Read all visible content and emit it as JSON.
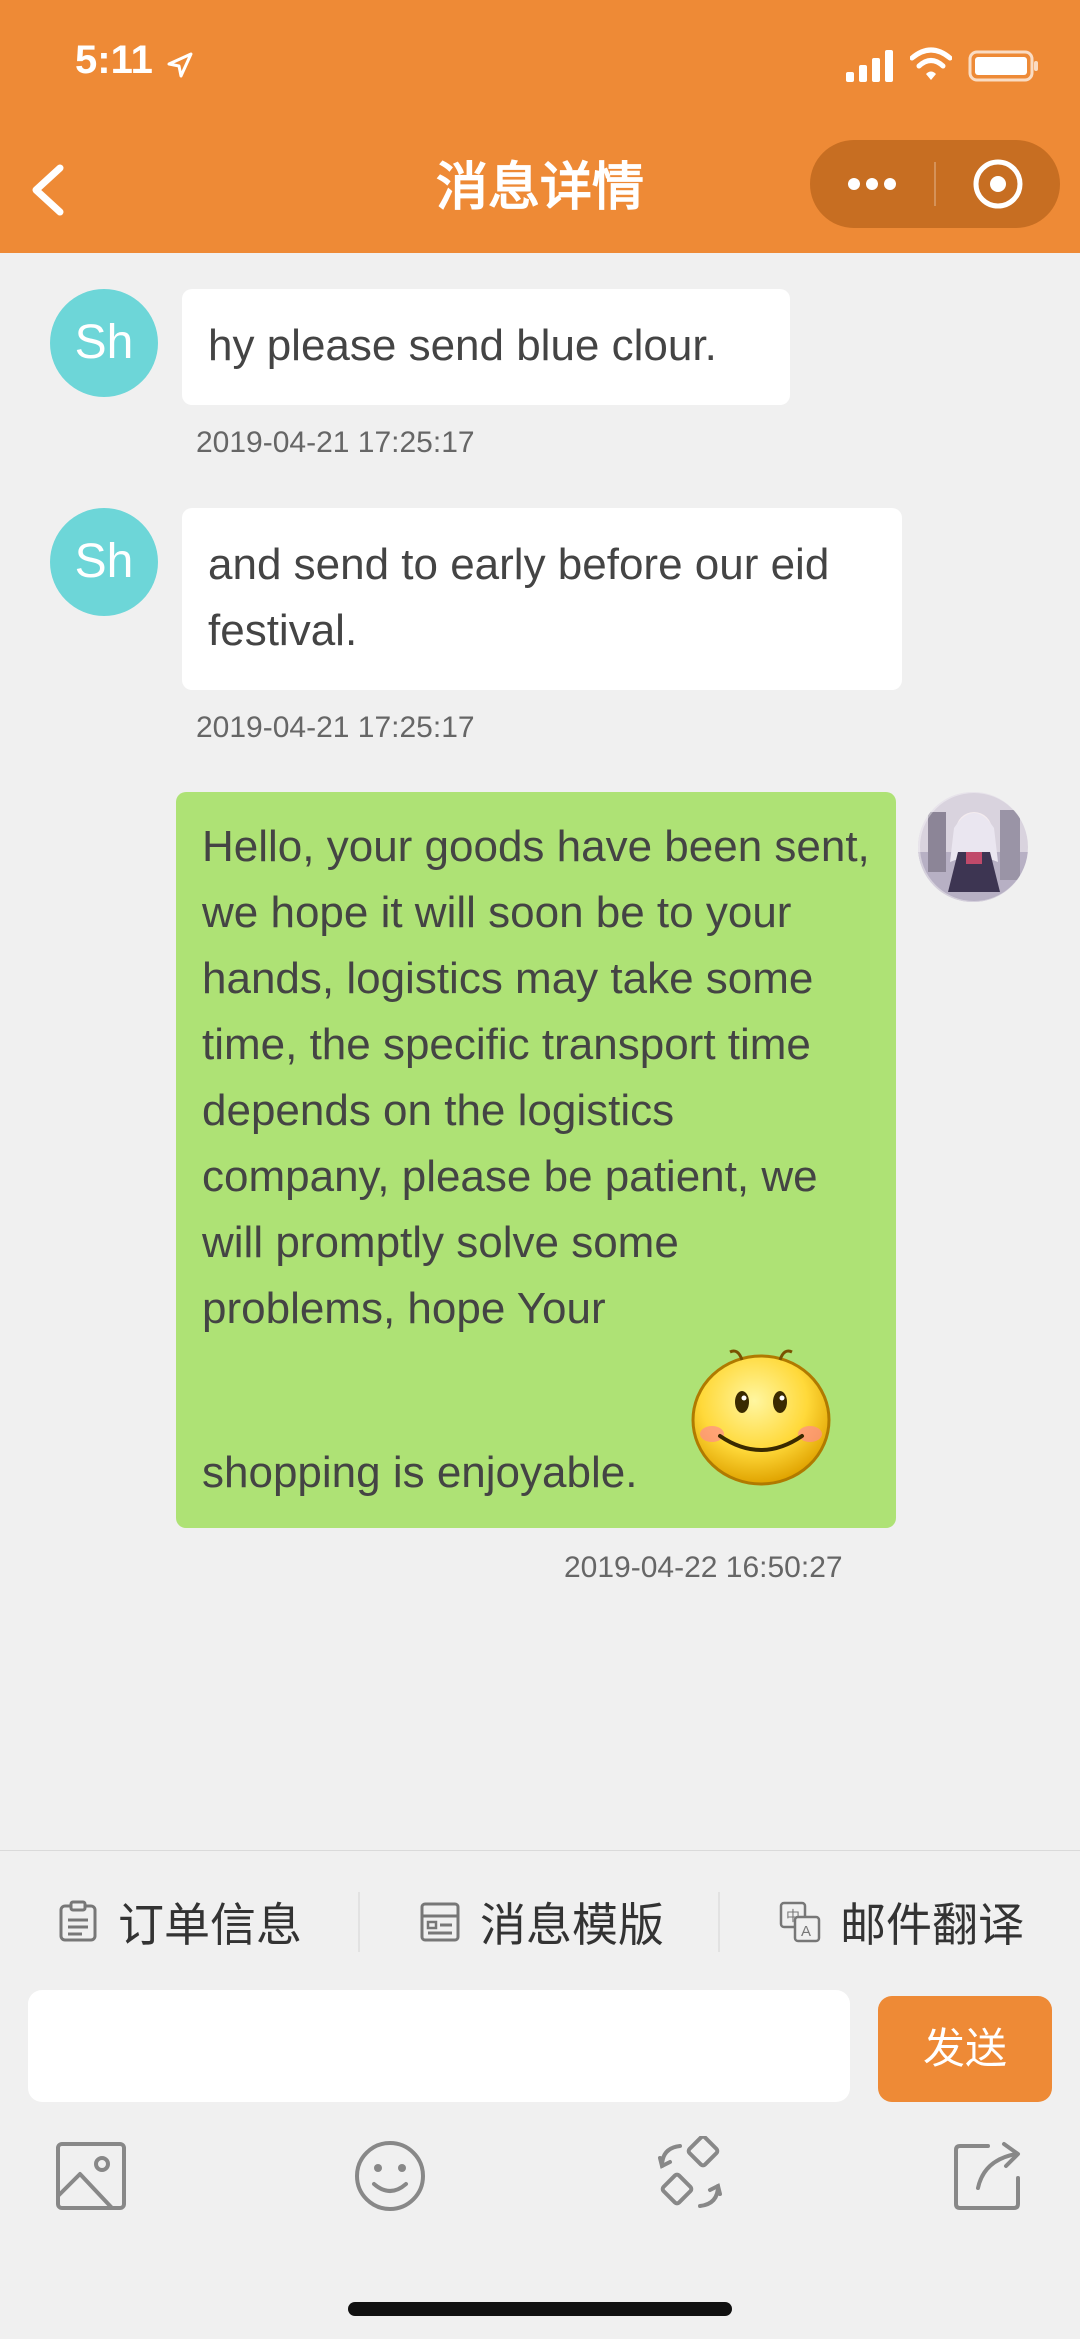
{
  "status_bar": {
    "time": "5:11"
  },
  "header": {
    "title": "消息详情"
  },
  "messages": [
    {
      "avatar_text": "Sh",
      "text": "hy please send blue clour.",
      "time": "2019-04-21 17:25:17"
    },
    {
      "avatar_text": "Sh",
      "text": "and send to early before our eid festival.",
      "time": "2019-04-21 17:25:17"
    },
    {
      "text_main": "Hello, your goods have been sent, we hope it will soon be to your hands, logistics may take some time, the specific transport time depends on the logistics company, please be patient, we will promptly solve some problems, hope Your",
      "text_tail": "shopping is enjoyable.",
      "time": "2019-04-22 16:50:27"
    }
  ],
  "toolbar": {
    "order_info": "订单信息",
    "msg_template": "消息模版",
    "mail_translate": "邮件翻译"
  },
  "composer": {
    "input_value": "",
    "send_label": "发送"
  },
  "colors": {
    "brand": "#ee8a36",
    "avatar": "#6dd6d8",
    "outgoing_bubble": "#aee275"
  },
  "icons": [
    "back-icon",
    "more-icon",
    "close-target-icon",
    "order-icon",
    "template-icon",
    "translate-icon",
    "image-icon",
    "emoji-icon",
    "shortcut-icon",
    "share-icon",
    "smiley-emoji"
  ]
}
